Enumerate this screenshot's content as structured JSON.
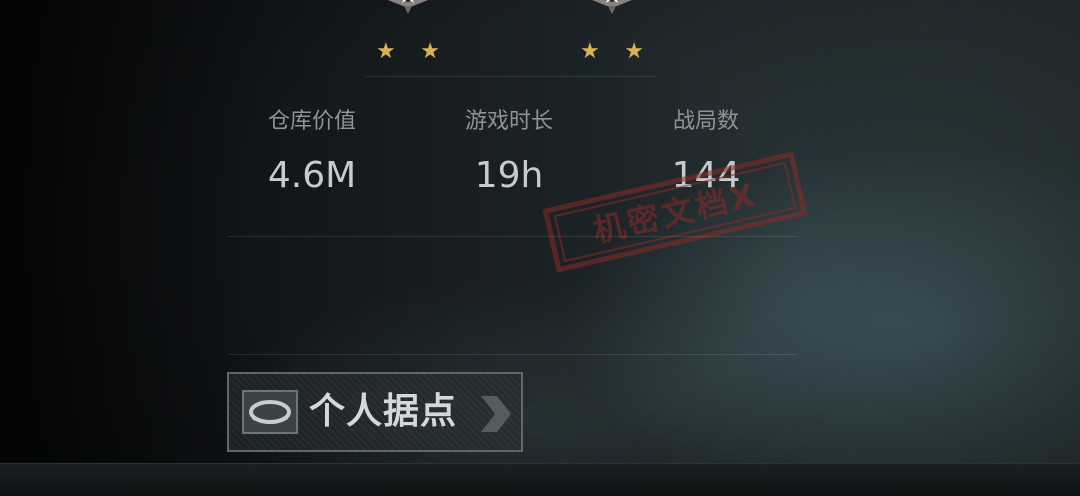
{
  "ranks": [
    {
      "icon": "rank-badge-icon",
      "stars": [
        "★",
        "★"
      ]
    },
    {
      "icon": "rank-badge-icon",
      "stars": [
        "★",
        "★"
      ]
    }
  ],
  "stats": [
    {
      "label": "仓库价值",
      "value": "4.6M"
    },
    {
      "label": "游戏时长",
      "value": "19h"
    },
    {
      "label": "战局数",
      "value": "144"
    }
  ],
  "stamp_text": "机密文档X",
  "personal_base": {
    "label": "个人据点",
    "icon": "base-icon",
    "arrow_icon": "chevron-right-icon"
  },
  "colors": {
    "star": "#d9b44a",
    "stamp": "#8b2a25",
    "text": "#c7cbcc",
    "label": "#8e9496"
  }
}
